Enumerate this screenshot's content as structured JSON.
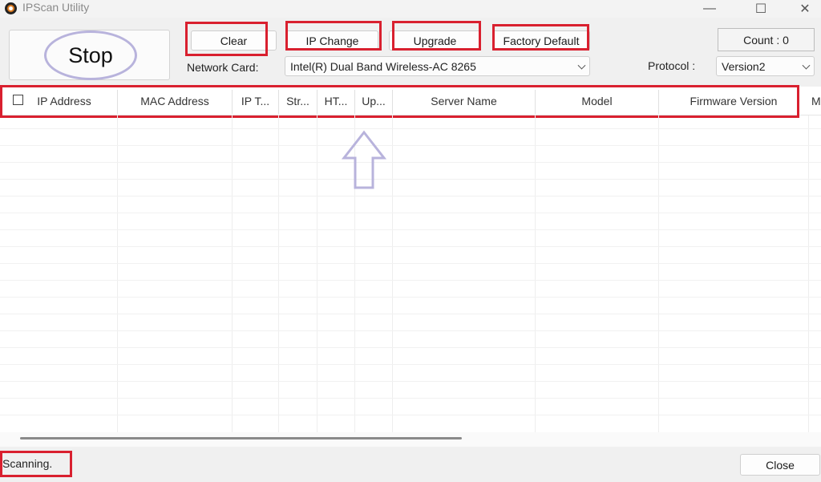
{
  "window": {
    "title": "IPScan Utility",
    "controls": {
      "minimize": "—",
      "maximize": "☐",
      "close": "✕"
    }
  },
  "toolbar": {
    "stop_label": "Stop",
    "clear_label": "Clear",
    "ip_change_label": "IP Change",
    "upgrade_label": "Upgrade",
    "factory_default_label": "Factory Default",
    "count_label": "Count : 0"
  },
  "network_card": {
    "label": "Network Card:",
    "selected": "Intel(R) Dual Band Wireless-AC 8265"
  },
  "protocol": {
    "label": "Protocol :",
    "selected": "Version2"
  },
  "table": {
    "columns": [
      "IP Address",
      "MAC Address",
      "IP T...",
      "Str...",
      "HT...",
      "Up...",
      "Server Name",
      "Model",
      "Firmware Version",
      "M"
    ],
    "rows": []
  },
  "statusbar": {
    "status_text": "Scanning.",
    "close_label": "Close"
  },
  "colors": {
    "highlight_box": "#d9202f",
    "annotation": "#b8b3dc"
  }
}
